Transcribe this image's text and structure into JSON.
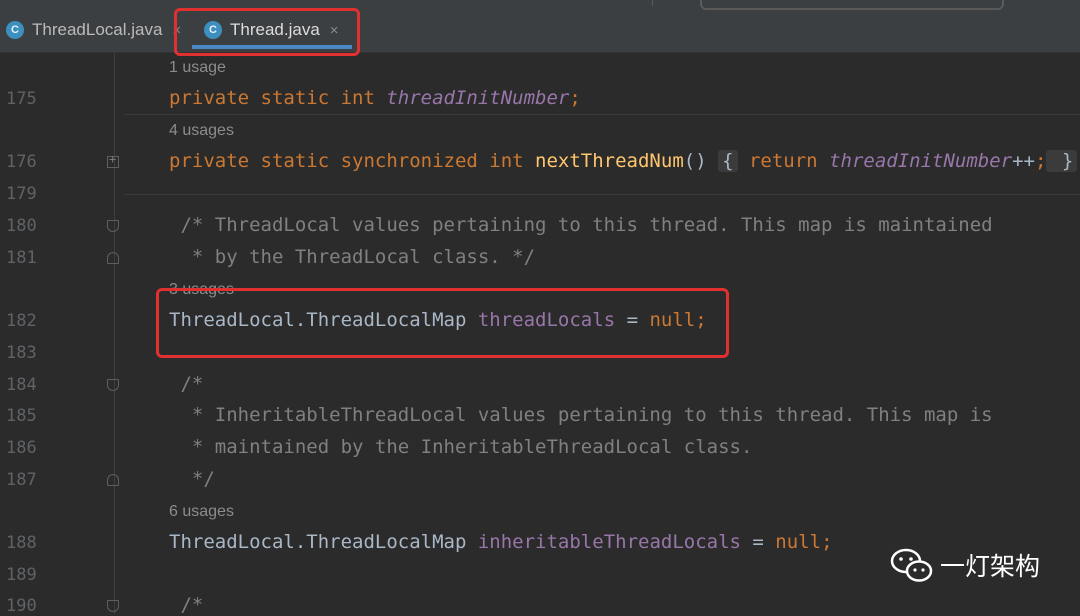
{
  "tabs": [
    {
      "label": "ThreadLocal.java",
      "icon": "class-c-icon",
      "active": false
    },
    {
      "label": "Thread.java",
      "icon": "class-c-icon",
      "active": true
    }
  ],
  "class_icon_letter": "C",
  "close_glyph": "×",
  "usages": {
    "u175": "1 usage",
    "u176": "4 usages",
    "u182": "3 usages",
    "u188": "6 usages"
  },
  "line_numbers": [
    "175",
    "176",
    "179",
    "180",
    "181",
    "182",
    "183",
    "184",
    "185",
    "186",
    "187",
    "188",
    "189",
    "190"
  ],
  "code": {
    "l175": {
      "kw": "private static int ",
      "field": "threadInitNumber",
      "end": ";"
    },
    "l176": {
      "kw1": "private static synchronized int ",
      "method": "nextThreadNum",
      "paren": "() ",
      "brace_open": "{",
      "kw2": " return ",
      "field": "threadInitNumber",
      "op": "++",
      "semi": ";",
      "brace_close": " }"
    },
    "l180": " /* ThreadLocal values pertaining to this thread. This map is maintained",
    "l181": "  * by the ThreadLocal class. */",
    "l182": {
      "type": "ThreadLocal.ThreadLocalMap ",
      "field": "threadLocals",
      "eq": " = ",
      "kw": "null",
      "end": ";"
    },
    "l184": " /*",
    "l185": "  * InheritableThreadLocal values pertaining to this thread. This map is",
    "l186": "  * maintained by the InheritableThreadLocal class.",
    "l187": "  */",
    "l188": {
      "type": "ThreadLocal.ThreadLocalMap ",
      "field": "inheritableThreadLocals",
      "eq": " = ",
      "kw": "null",
      "end": ";"
    },
    "l190": " /*"
  },
  "watermark": "一灯架构",
  "colors": {
    "highlight_border": "#e0302f",
    "keyword": "#cc7832",
    "field": "#9876aa",
    "method": "#ffc66d",
    "comment": "#808080"
  }
}
